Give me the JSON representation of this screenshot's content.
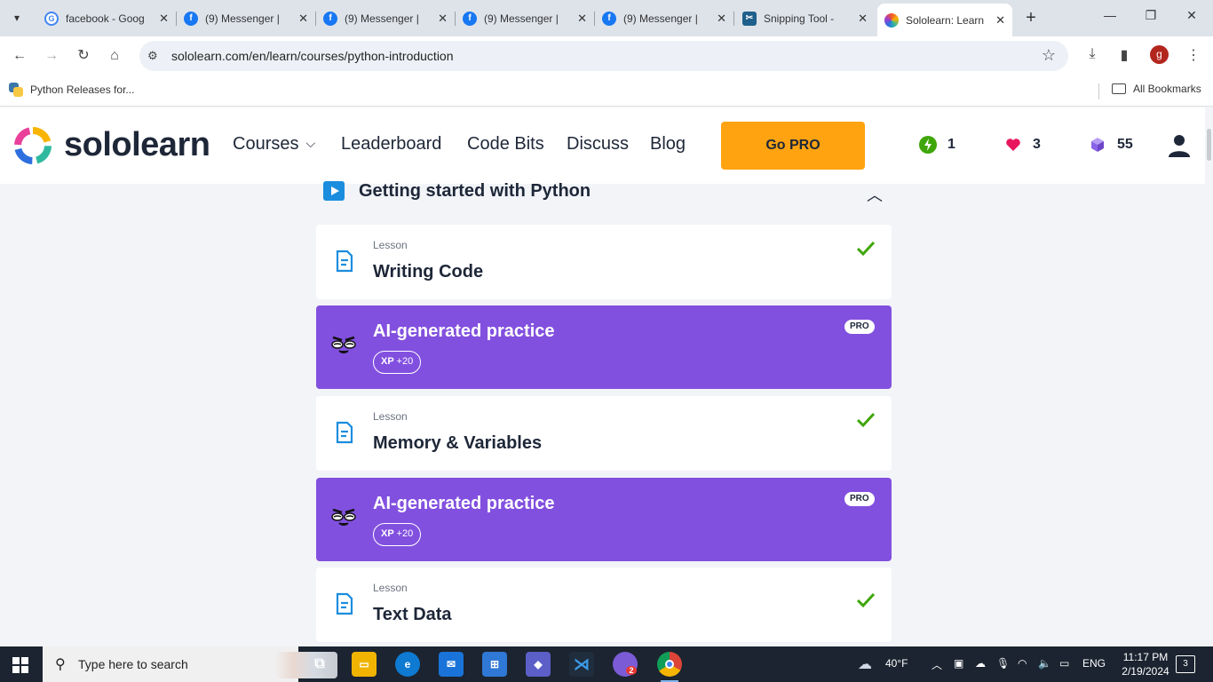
{
  "browser": {
    "tabs": [
      {
        "title": "facebook - Goog",
        "icon": "google-icon",
        "color": "#4285f4"
      },
      {
        "title": "(9) Messenger |",
        "icon": "facebook-icon",
        "color": "#1877f2"
      },
      {
        "title": "(9) Messenger |",
        "icon": "facebook-icon",
        "color": "#1877f2"
      },
      {
        "title": "(9) Messenger |",
        "icon": "facebook-icon",
        "color": "#1877f2"
      },
      {
        "title": "(9) Messenger |",
        "icon": "facebook-icon",
        "color": "#1877f2"
      },
      {
        "title": "Snipping Tool -",
        "icon": "snipping-tool-icon",
        "color": "#1f5f8b"
      },
      {
        "title": "Sololearn: Learn",
        "icon": "sololearn-icon",
        "color": "#e24a8b"
      }
    ],
    "url": "sololearn.com/en/learn/courses/python-introduction",
    "profile_initial": "g",
    "bookmarks": {
      "item": "Python Releases for...",
      "all": "All Bookmarks"
    }
  },
  "header": {
    "logo": "sololearn",
    "nav": {
      "courses": "Courses",
      "leaderboard": "Leaderboard",
      "code_bits": "Code Bits",
      "discuss": "Discuss",
      "blog": "Blog"
    },
    "go_pro": "Go PRO",
    "stats": {
      "streak": "1",
      "hearts": "3",
      "gems": "55"
    }
  },
  "course": {
    "section_title": "Getting started with Python",
    "items": [
      {
        "kind": "Lesson",
        "title": "Writing Code",
        "completed": true
      },
      {
        "title": "AI-generated practice",
        "xp_label": "XP",
        "xp_value": "+20",
        "pro": "PRO"
      },
      {
        "kind": "Lesson",
        "title": "Memory & Variables",
        "completed": true
      },
      {
        "title": "AI-generated practice",
        "xp_label": "XP",
        "xp_value": "+20",
        "pro": "PRO"
      },
      {
        "kind": "Lesson",
        "title": "Text Data",
        "completed": true
      }
    ]
  },
  "taskbar": {
    "search_placeholder": "Type here to search",
    "weather": "40°F",
    "language": "ENG",
    "time": "11:17 PM",
    "date": "2/19/2024",
    "notifications": "3",
    "copilot_badge": "2"
  },
  "colors": {
    "accent_purple": "#8250df",
    "go_pro": "#ffa310",
    "check_green": "#3fa60a"
  }
}
